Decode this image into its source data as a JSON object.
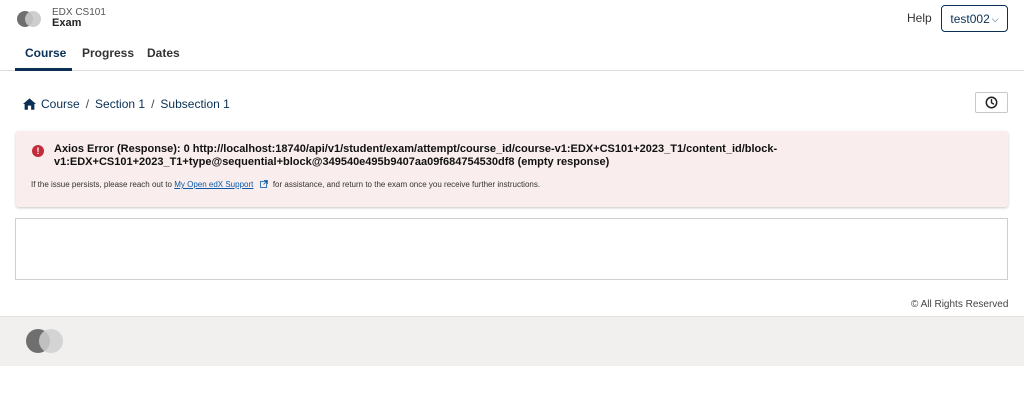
{
  "header": {
    "course_org": "EDX CS101",
    "course_title": "Exam",
    "help_label": "Help",
    "user_label": "test002",
    "user_caret": "⌵"
  },
  "tabs": [
    {
      "label": "Course",
      "active": true
    },
    {
      "label": "Progress",
      "active": false
    },
    {
      "label": "Dates",
      "active": false
    }
  ],
  "breadcrumb": {
    "items": [
      "Course",
      "Section 1",
      "Subsection 1"
    ],
    "separator": "/"
  },
  "alert": {
    "icon": "!",
    "title": "Axios Error (Response): 0 http://localhost:18740/api/v1/student/exam/attempt/course_id/course-v1:EDX+CS101+2023_T1/content_id/block-v1:EDX+CS101+2023_T1+type@sequential+block@349540e495b9407aa09f684754530df8 (empty response)",
    "body_before": "If the issue persists, please reach out to",
    "link_text": "My Open edX Support",
    "body_after": "for assistance, and return to the exam once you receive further instructions."
  },
  "footer": {
    "rights": "© All Rights Reserved"
  },
  "colors": {
    "brand": "#0a3055",
    "alert_bg": "#f9eded",
    "alert_icon": "#c32d3a",
    "link": "#0a5aa8"
  },
  "icons": {
    "home": "home-icon",
    "clock": "clock-icon",
    "error": "error-icon",
    "external_link": "external-link-icon"
  }
}
